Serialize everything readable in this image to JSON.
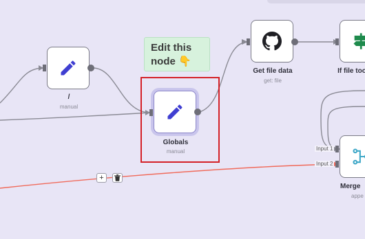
{
  "sticky_note": {
    "text": "Edit this node 👇"
  },
  "nodes": {
    "slash_node": {
      "title": "/",
      "subtitle": "manual",
      "icon": "pencil-icon"
    },
    "globals_node": {
      "title": "Globals",
      "subtitle": "manual",
      "icon": "pencil-icon"
    },
    "get_file_data": {
      "title": "Get file data",
      "subtitle": "get: file",
      "icon": "github-icon"
    },
    "if_file_node": {
      "title": "If file too",
      "icon": "signpost-icon"
    },
    "merge_node": {
      "title": "Merge",
      "subtitle": "appe",
      "icon": "merge-icon",
      "inputs": [
        "Input 1",
        "Input 2"
      ]
    }
  },
  "edge_toolbar": {
    "add_label": "+",
    "delete_icon": "trash-icon"
  },
  "colors": {
    "canvas_bg": "#e8e5f6",
    "pencil": "#3f3ed1",
    "github": "#1f1f24",
    "signpost": "#1e8a4c",
    "merge": "#3fa8c8",
    "highlight": "#d42027",
    "error_edge": "#f06a5a",
    "edge": "#8a8a94"
  }
}
